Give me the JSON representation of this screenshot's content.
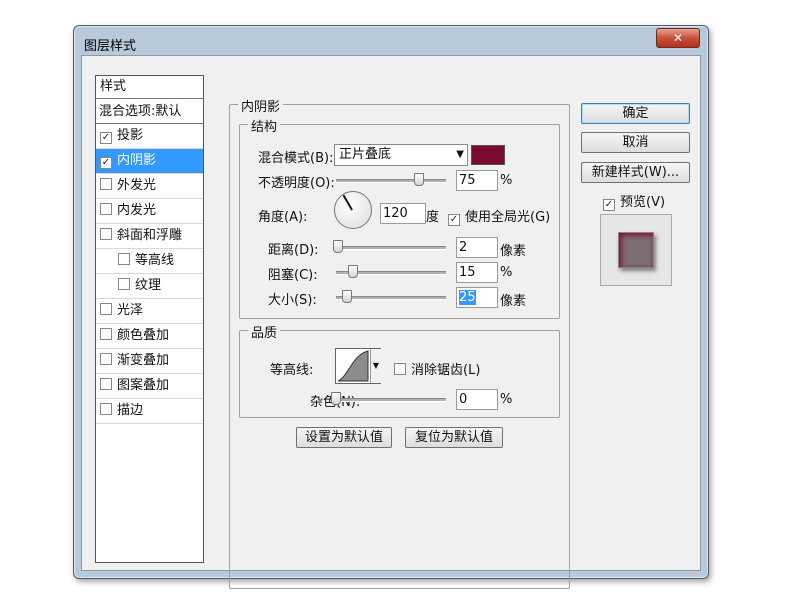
{
  "window": {
    "title": "图层样式",
    "close": "✕"
  },
  "style_list": {
    "header": "样式",
    "blend": "混合选项:默认",
    "items": [
      {
        "label": "投影",
        "checked": true
      },
      {
        "label": "内阴影",
        "checked": true
      },
      {
        "label": "外发光",
        "checked": false
      },
      {
        "label": "内发光",
        "checked": false
      },
      {
        "label": "斜面和浮雕",
        "checked": false
      },
      {
        "label": "等高线",
        "checked": false
      },
      {
        "label": "纹理",
        "checked": false
      },
      {
        "label": "光泽",
        "checked": false
      },
      {
        "label": "颜色叠加",
        "checked": false
      },
      {
        "label": "渐变叠加",
        "checked": false
      },
      {
        "label": "图案叠加",
        "checked": false
      },
      {
        "label": "描边",
        "checked": false
      }
    ],
    "check": "✓"
  },
  "inner_shadow": {
    "title": "内阴影",
    "structure": {
      "title": "结构",
      "blend_mode_label": "混合模式(B):",
      "blend_mode_value": "正片叠底",
      "dropdown_arrow": "▼",
      "color": "#7a0a30",
      "opacity_label": "不透明度(O):",
      "opacity_value": "75",
      "opacity_unit": "%",
      "opacity_fraction": 0.75,
      "angle_label": "角度(A):",
      "angle_value": "120",
      "angle_unit": "度",
      "global_light_label": "使用全局光(G)",
      "global_light_checked": true,
      "distance_label": "距离(D):",
      "distance_value": "2",
      "distance_unit": "像素",
      "distance_fraction": 0.02,
      "choke_label": "阻塞(C):",
      "choke_value": "15",
      "choke_unit": "%",
      "choke_fraction": 0.15,
      "size_label": "大小(S):",
      "size_value": "25",
      "size_unit": "像素",
      "size_fraction": 0.1
    },
    "quality": {
      "title": "品质",
      "contour_label": "等高线:",
      "antialias_label": "消除锯齿(L)",
      "antialias_checked": false,
      "noise_label": "杂色(N):",
      "noise_value": "0",
      "noise_unit": "%",
      "noise_fraction": 0
    },
    "make_default": "设置为默认值",
    "reset_default": "复位为默认值"
  },
  "buttons": {
    "ok": "确定",
    "cancel": "取消",
    "new_style": "新建样式(W)...",
    "preview": "预览(V)",
    "preview_checked": true
  },
  "colors": {
    "selection": "#3399ff",
    "shadow_color": "#7a0a30"
  }
}
